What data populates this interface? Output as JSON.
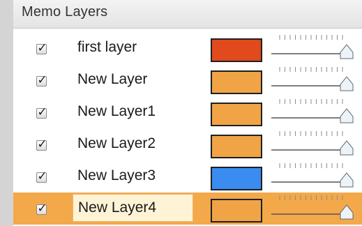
{
  "panel": {
    "title": "Memo Layers"
  },
  "layers": [
    {
      "name": "first layer",
      "visible": true,
      "color": "#e04a1c",
      "opacity": 1.0,
      "selected": false
    },
    {
      "name": "New Layer",
      "visible": true,
      "color": "#f0a445",
      "opacity": 1.0,
      "selected": false
    },
    {
      "name": "New Layer1",
      "visible": true,
      "color": "#f0a445",
      "opacity": 1.0,
      "selected": false
    },
    {
      "name": "New Layer2",
      "visible": true,
      "color": "#f0a445",
      "opacity": 1.0,
      "selected": false
    },
    {
      "name": "New Layer3",
      "visible": true,
      "color": "#3a8cf0",
      "opacity": 1.0,
      "selected": false
    },
    {
      "name": "New Layer4",
      "visible": true,
      "color": "#f0a445",
      "opacity": 1.0,
      "selected": true
    }
  ],
  "icons": {
    "checkbox": "checkmark-icon",
    "slider_thumb": "slider-thumb-icon"
  },
  "colors": {
    "selected_row": "#f3a84a",
    "header": "#e8e8e8",
    "background": "#d4d4d4"
  }
}
